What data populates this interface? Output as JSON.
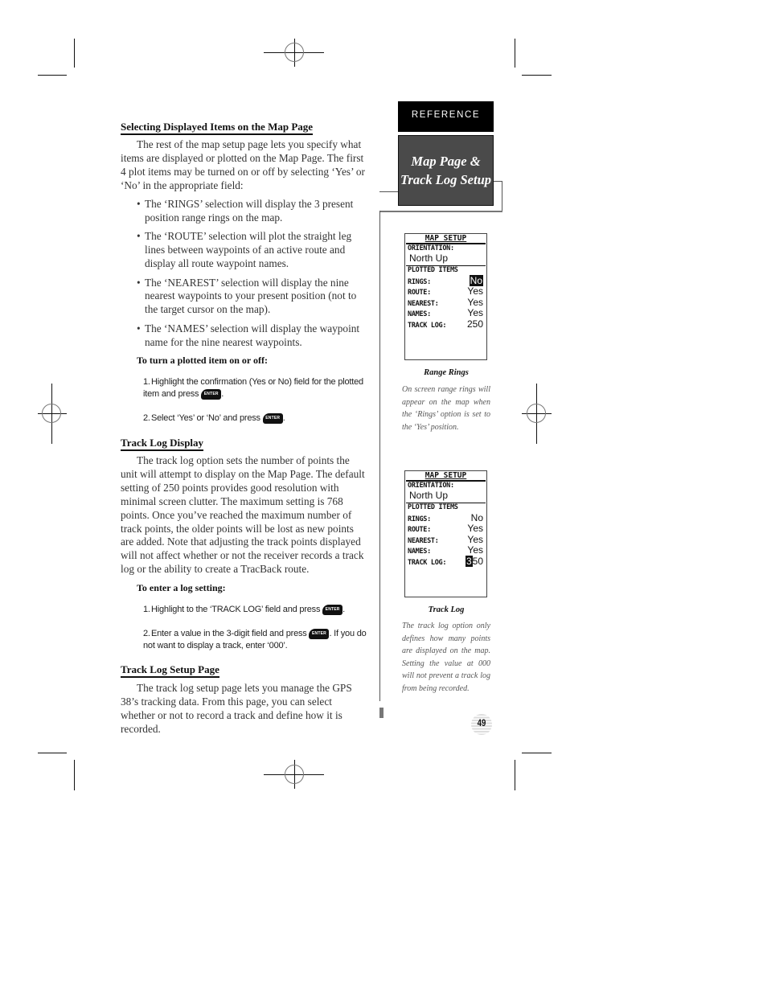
{
  "side_tab": {
    "label": "REFERENCE",
    "title_line1": "Map Page &",
    "title_line2": "Track Log Setup"
  },
  "sections": {
    "selecting": {
      "heading": "Selecting Displayed Items on the Map Page",
      "intro": "The rest of the map setup page lets you specify what items are displayed or plotted on the Map Page. The first 4 plot items may be turned on or off by selecting ‘Yes’ or ‘No’ in the appropriate field:",
      "bullets": [
        "The ‘RINGS’ selection will display the 3 present position range rings on the map.",
        "The ‘ROUTE’ selection will plot the straight leg lines between waypoints of an active route and display all route waypoint names.",
        "The ‘NEAREST’ selection will display the nine nearest waypoints to your present position (not to the target cursor on the map).",
        "The ‘NAMES’ selection will display the waypoint name for the nine nearest waypoints."
      ],
      "procedure_title": "To turn a plotted item on or off:",
      "steps": [
        {
          "num": "1.",
          "text": "Highlight the confirmation (Yes or No) field for the plotted item and press",
          "after": "."
        },
        {
          "num": "2.",
          "text": "Select ‘Yes’ or ‘No’ and press",
          "after": "."
        }
      ]
    },
    "track_log_display": {
      "heading": "Track Log Display",
      "body": "The track log option sets the number of points the unit will attempt to display on the Map Page. The default setting of 250 points provides good resolution with minimal screen clutter. The maximum setting is 768 points. Once you’ve reached the maximum number of track points, the older points will be lost as new points are added. Note that adjusting the track points displayed will not affect whether or not the receiver records a track log or the ability to create a TracBack route.",
      "procedure_title": "To enter a log setting:",
      "steps": [
        {
          "num": "1.",
          "text": "Highlight to the ‘TRACK LOG’ field and press",
          "after": "."
        },
        {
          "num": "2.",
          "text": "Enter a value in the 3-digit field and press",
          "after": ". If you do not want to display a track, enter ‘000’."
        }
      ]
    },
    "track_log_setup": {
      "heading": "Track Log Setup Page",
      "body": "The track log setup page lets you manage the GPS 38’s tracking data. From this page, you can select whether or not to record a track and define how it is recorded."
    }
  },
  "enter_key_label": "ENTER",
  "screens": [
    {
      "title": "MAP SETUP",
      "orientation_label": "ORIENTATION:",
      "orientation_value": "North Up",
      "plotted_label": "PLOTTED ITEMS",
      "rows": [
        {
          "key": "RINGS:",
          "value": "No",
          "highlight": "No"
        },
        {
          "key": "ROUTE:",
          "value": "Yes"
        },
        {
          "key": "NEAREST:",
          "value": "Yes"
        },
        {
          "key": "NAMES:",
          "value": "Yes"
        },
        {
          "key": "TRACK LOG:",
          "value": "250"
        }
      ],
      "caption_title": "Range Rings",
      "caption_text": "On screen range rings will appear on the map when the ‘Rings’ option is set to the ‘Yes’ position."
    },
    {
      "title": "MAP SETUP",
      "orientation_label": "ORIENTATION:",
      "orientation_value": "North Up",
      "plotted_label": "PLOTTED ITEMS",
      "rows": [
        {
          "key": "RINGS:",
          "value": "No"
        },
        {
          "key": "ROUTE:",
          "value": "Yes"
        },
        {
          "key": "NEAREST:",
          "value": "Yes"
        },
        {
          "key": "NAMES:",
          "value": "Yes"
        },
        {
          "key": "TRACK LOG:",
          "value_highlight": "3",
          "value_rest": "50"
        }
      ],
      "caption_title": "Track Log",
      "caption_text": "The track log option only defines how many points are displayed on the map. Setting the value at 000 will not prevent a track log from being recorded."
    }
  ],
  "page_number": "49"
}
